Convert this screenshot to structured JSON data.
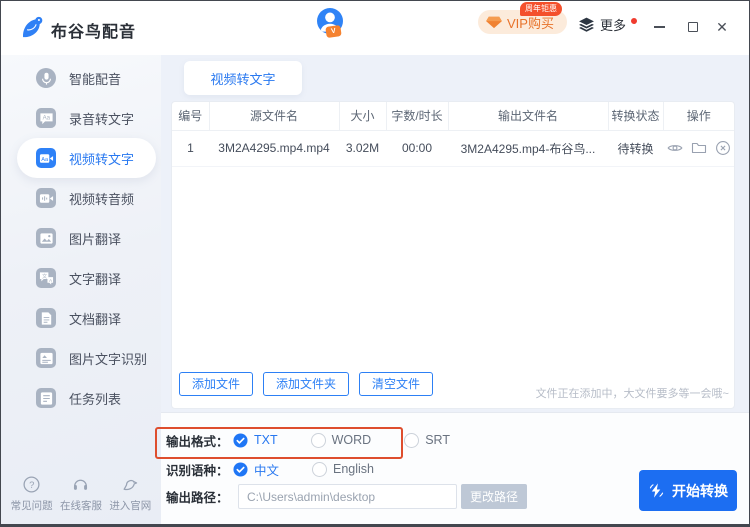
{
  "colors": {
    "accent": "#2878f0",
    "start_button": "#1c6ef2",
    "annotation_box": "#de4e2e",
    "vip_text": "#e8722a",
    "vip_badge_bg": "#f4502c",
    "notification_dot": "#f03b2e"
  },
  "titlebar": {
    "title": "布谷鸟配音",
    "vip_button": "VIP购买",
    "vip_badge": "周年钜惠",
    "more_label": "更多"
  },
  "sidebar": {
    "items": [
      {
        "label": "智能配音"
      },
      {
        "label": "录音转文字"
      },
      {
        "label": "视频转文字",
        "active": true
      },
      {
        "label": "视频转音频"
      },
      {
        "label": "图片翻译"
      },
      {
        "label": "文字翻译"
      },
      {
        "label": "文档翻译"
      },
      {
        "label": "图片文字识别"
      },
      {
        "label": "任务列表"
      }
    ],
    "footer": [
      {
        "label": "常见问题"
      },
      {
        "label": "在线客服"
      },
      {
        "label": "进入官网"
      }
    ]
  },
  "main": {
    "tab_label": "视频转文字",
    "table": {
      "headers": [
        "编号",
        "源文件名",
        "大小",
        "字数/时长",
        "输出文件名",
        "转换状态",
        "操作"
      ],
      "rows": [
        {
          "no": "1",
          "source": "3M2A4295.mp4.mp4",
          "size": "3.02M",
          "words_duration": "00:00",
          "output": "3M2A4295.mp4-布谷鸟...",
          "status": "待转换"
        }
      ]
    },
    "file_buttons": {
      "add_file": "添加文件",
      "add_folder": "添加文件夹",
      "clear": "清空文件"
    },
    "hint": "文件正在添加中，大文件要多等一会哦~",
    "options": {
      "format_label": "输出格式：",
      "formats": [
        {
          "label": "TXT",
          "selected": true
        },
        {
          "label": "WORD",
          "selected": false
        },
        {
          "label": "SRT",
          "selected": false
        }
      ],
      "language_label": "识别语种：",
      "languages": [
        {
          "label": "中文",
          "selected": true
        },
        {
          "label": "English",
          "selected": false
        }
      ],
      "path_label": "输出路径：",
      "path_value": "C:\\Users\\admin\\desktop",
      "change_path_label": "更改路径",
      "start_label": "开始转换"
    }
  }
}
